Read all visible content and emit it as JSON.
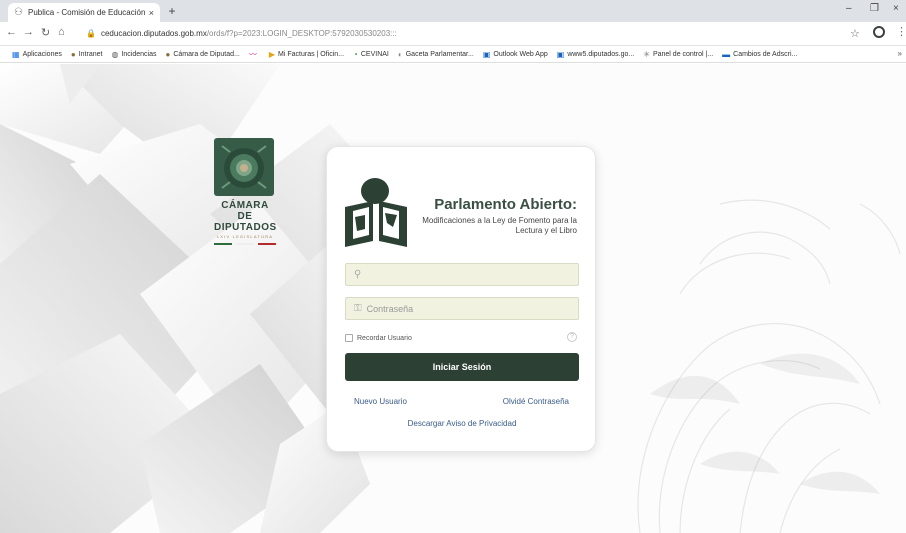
{
  "browser": {
    "tab_title": "Publica - Comisión de Educación",
    "tab_close": "×",
    "new_tab": "+",
    "url_main": "ceducacion.diputados.gob.mx",
    "url_rest": "/ords/f?p=2023:LOGIN_DESKTOP:5792030530203:::",
    "win_min": "–",
    "win_max": "❐",
    "win_close": "×"
  },
  "bookmarks": [
    {
      "icon": "apps-icon",
      "label": "Aplicaciones",
      "color": "#1a73e8"
    },
    {
      "icon": "intranet-icon",
      "label": "Intranet",
      "color": "#8a6d3b"
    },
    {
      "icon": "globe-icon",
      "label": "Incidencias",
      "color": "#555555"
    },
    {
      "icon": "camara-icon",
      "label": "Cámara de Diputad...",
      "color": "#8a6d3b"
    },
    {
      "icon": "bird-icon",
      "label": "",
      "color": "#d63384"
    },
    {
      "icon": "facturas-icon",
      "label": "Mi Facturas | Oficin...",
      "color": "#e8a317"
    },
    {
      "icon": "cevinai-icon",
      "label": "CEVINAI",
      "color": "#2e7d32"
    },
    {
      "icon": "gaceta-icon",
      "label": "Gaceta Parlamentar...",
      "color": "#888888"
    },
    {
      "icon": "outlook-icon",
      "label": "Outlook Web App",
      "color": "#1565c0"
    },
    {
      "icon": "www5-icon",
      "label": "www5.diputados.go...",
      "color": "#1565c0"
    },
    {
      "icon": "panel-icon",
      "label": "Panel de control |...",
      "color": "#777777"
    },
    {
      "icon": "cambios-icon",
      "label": "Cambios de Adscri...",
      "color": "#1565c0"
    }
  ],
  "bookmarks_more": "»",
  "logo": {
    "line1": "CÁMARA DE",
    "line2": "DIPUTADOS",
    "legislature": "LXIV LEGISLATURA",
    "colors": [
      "#2e6b3f",
      "#ffffff",
      "#b52a2a"
    ]
  },
  "login": {
    "title": "Parlamento Abierto:",
    "subtitle": "Modificaciones a la Ley de Fomento para la Lectura y el Libro",
    "username_placeholder": "",
    "password_placeholder": "Contraseña",
    "remember_label": "Recordar Usuario",
    "help_glyph": "?",
    "submit_label": "Iniciar Sesión",
    "new_user": "Nuevo Usuario",
    "forgot_password": "Olvidé Contraseña",
    "privacy": "Descargar Aviso de Privacidad",
    "accent": "#2c4034"
  }
}
